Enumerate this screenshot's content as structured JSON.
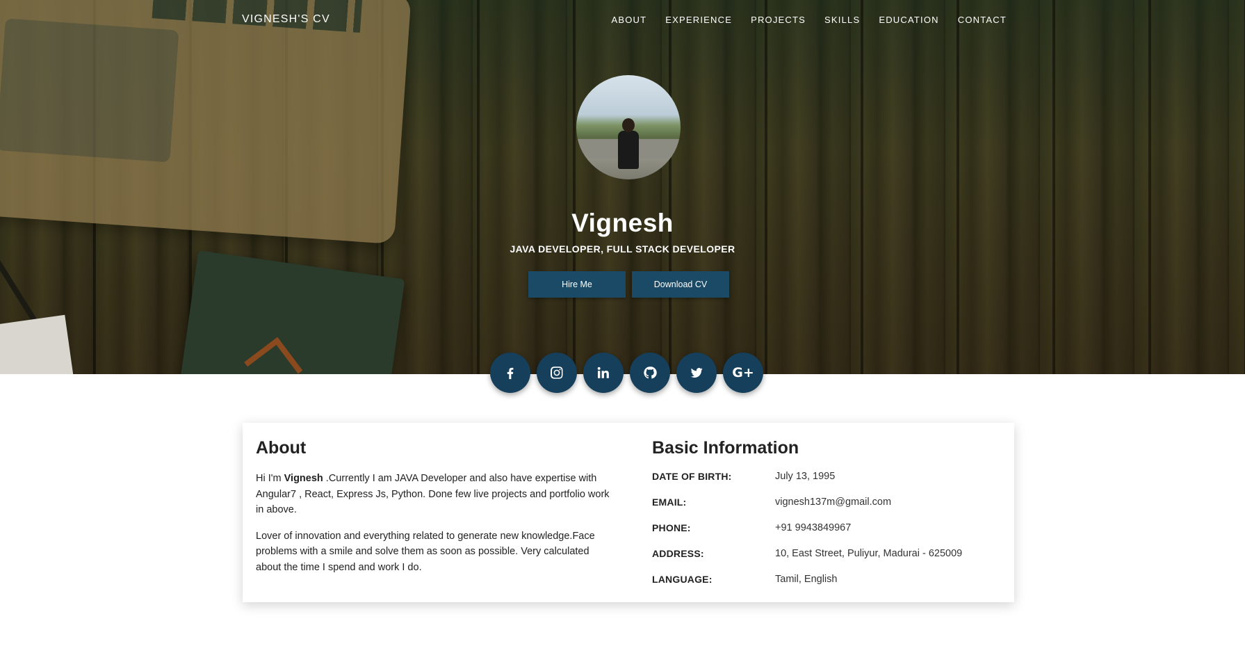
{
  "nav": {
    "brand": "VIGNESH'S CV",
    "links": [
      "ABOUT",
      "EXPERIENCE",
      "PROJECTS",
      "SKILLS",
      "EDUCATION",
      "CONTACT"
    ]
  },
  "profile": {
    "name": "Vignesh",
    "title": "JAVA DEVELOPER, FULL STACK DEVELOPER",
    "hire_label": "Hire Me",
    "download_label": "Download CV"
  },
  "social": [
    {
      "icon": "facebook-icon"
    },
    {
      "icon": "instagram-icon"
    },
    {
      "icon": "linkedin-icon"
    },
    {
      "icon": "github-icon"
    },
    {
      "icon": "twitter-icon"
    },
    {
      "icon": "google-plus-icon",
      "glyph": "G+"
    }
  ],
  "about": {
    "heading": "About",
    "intro_prefix": "Hi I'm ",
    "intro_name": "Vignesh",
    "intro_rest": " .Currently I am JAVA Developer and also have expertise with Angular7 , React, Express Js, Python. Done few live projects and portfolio work in above.",
    "paragraph2": "Lover of innovation and everything related to generate new knowledge.Face problems with a smile and solve them as soon as possible. Very calculated about the time I spend and work I do."
  },
  "info": {
    "heading": "Basic Information",
    "rows": [
      {
        "label": "DATE OF BIRTH:",
        "value": "July 13, 1995"
      },
      {
        "label": "EMAIL:",
        "value": "vignesh137m@gmail.com"
      },
      {
        "label": "PHONE:",
        "value": "+91 9943849967"
      },
      {
        "label": "ADDRESS:",
        "value": "10, East Street, Puliyur, Madurai - 625009"
      },
      {
        "label": "LANGUAGE:",
        "value": "Tamil, English"
      }
    ]
  },
  "colors": {
    "button": "#1b4a66",
    "social": "#153f5a"
  }
}
